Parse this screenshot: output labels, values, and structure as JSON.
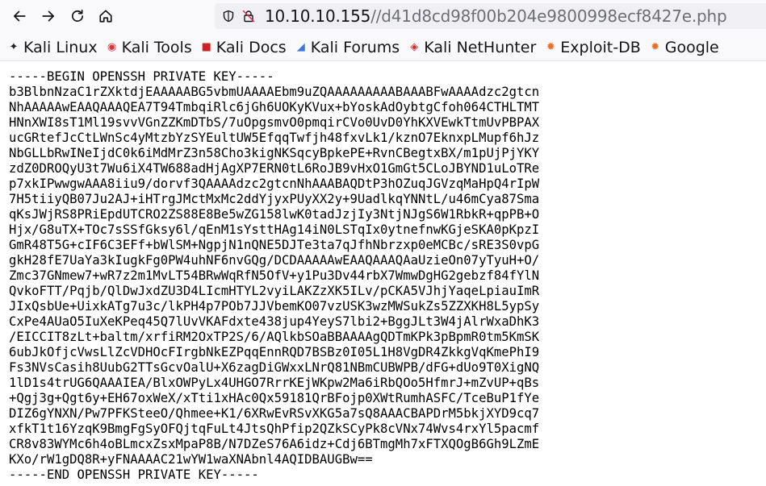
{
  "browser": {
    "url_host": "10.10.10.155",
    "url_path": "//d41d8cd98f00b204e9800998ecf8427e.php"
  },
  "bookmarks": [
    {
      "label": "Kali Linux",
      "icon": "kali-dragon-icon",
      "color": "#222222"
    },
    {
      "label": "Kali Tools",
      "icon": "kali-tools-icon",
      "color": "#d9383a"
    },
    {
      "label": "Kali Docs",
      "icon": "kali-docs-icon",
      "color": "#cc2222"
    },
    {
      "label": "Kali Forums",
      "icon": "kali-forums-icon",
      "color": "#3a7bd5"
    },
    {
      "label": "Kali NetHunter",
      "icon": "kali-nethunter-icon",
      "color": "#d12a2a"
    },
    {
      "label": "Exploit-DB",
      "icon": "exploit-db-icon",
      "color": "#e8702a"
    },
    {
      "label": "Google",
      "icon": "google-icon",
      "color": "#e8702a"
    }
  ],
  "page": {
    "lines": [
      "-----BEGIN OPENSSH PRIVATE KEY-----",
      "b3BlbnNzaC1rZXktdjEAAAAABG5vbmUAAAAEbm9uZQAAAAAAAAABAAABFwAAAAdzc2gtcn",
      "NhAAAAAwEAAQAAAQEA7T94TmbqiRlc6jGh6UOKyKVux+bYoskAdOybtgCfoh064CTHLTMT",
      "HNnXWI8sT1Ml19svvVGnZZKmDTbS/7uOpgsmvO0pmqirCVo0UvD0YhKXVEwkTtmUvPBPAX",
      "ucGRtefJcCtLWnSc4yMtzbYzSYEultUW5EfqqTwfjh48fxvLk1/kznO7EknxpLMupf6hJz",
      "NbGLLbRwINeIjdC0k6iMdMrZ3n58Cho3kigNKSqcyBpkePE+RvnCBegtxBX/m1pUjPjYKY",
      "zdZ0DROQyU3t7Wu6iX4TW688adHjAgXP7ERN0tL6RoJB9vHxO1GmGt5CLoJBYND1uLoTRe",
      "p7xkIPwwgwAAA8iiu9/dorvf3QAAAAdzc2gtcnNhAAABAQDtP3hOZuqJGVzqMaHpQ4rIpW",
      "7H5tiiyQB07Ju2AJ+iHTrgJMctMxMc2ddYjyxPUyXX2y+9UadlkqYNNtL/u46mCya87Sma",
      "qKsJWjRS8PRiEpdUTCRO2ZS88E8Be5wZG158lwK0tadJzjIy3NtjNJgS6W1RbkR+qpPB+O",
      "Hjx/G8uTX+TOc7sSSfGksy6l/qEnM1sYsttHAg14iN0LSTqIx0ytnefnwKGjeSKA0pKpzI",
      "GmR48T5G+cIF6C3EFf+bWlSM+NgpjN1nQNE5DJTe3ta7qJfhNbrzxp0eMCBc/sRE3S0vpG",
      "gkH28fE7UaYa3kIugkFg0PW4uhNF6nvGQg/DCDAAAAAwEAAQAAAQAaUzieOn07yTyuH+O/",
      "Zmc37GNmew7+wR7z2m1MvLT54BRwWqRfN5OfV+y1Pu3Dv44rbX7WmwDgHG2gebzf84fYlN",
      "QvkoFTT/Pqjb/QlDwJxdZU3D4LIcmHTYL2vyiLAKZzXK5ILv/pCKA5VJhjYaqeLpiauImR",
      "JIxQsbUe+UixkATg7u3c/lkPH4p7POb7JJVbemKO07vzUSK3wzMWSukZs5ZZXKH8L5ypSy",
      "CxPe4AUaO5IuXeKPeq45Q7lUvVKAFdxte438jup4YeyS7lbi2+BggJLt3W4jAlrWxaDhK3",
      "/EICCIT8zLt+baltm/xrfiRM2OxTP2S/6/AQlkbSOaBBAAAAgQDTmKPk3pBpmR0tm5KmSK",
      "6ubJkOfjcVwsLlZcVDHOcFIrgbNkEZPqqEnnRQD7BSBz0I05L1H8VgDR4ZkkgVqKmePhI9",
      "Fs3NVsCasih8UubG2TTsGcvOalU+X6zagDiGWxxLNrQ81NBmCUBWPB/dFG+dUo9T0XigNQ",
      "1lD1s4trUG6QAAAIEA/BlxOWPyLx4UHGO7RrrKEjWKpw2Ma6iRbQOo5HfmrJ+mZvUP+qBs",
      "+Qgj3g+Qgt6y+EH67oxWeX/xTti1xHAc0Qx59181QrBFojp0XWtRumhASFC/TceBuP1fYe",
      "DIZ6gYNXN/Pw7PFKSteeO/Qhmee+K1/6XRwEvRSvXKG5a7sQ8AAACBAPDrM5bkjXYD9cq7",
      "xfkT1t16YzqK9BmgFgSyOFQjtqFuLt4JtsQhPfip2QZkSCyPk8cVNx74Wvs4rxYl5pacmf",
      "CR8v83WYMc6h4oBLmcxZsxMpaP8B/N7DZeS76A6idz+Cdj6BTmgMh7xFTXQOgB6Gh9LZmE",
      "KXo/rW1gDQ8R+yFNAAAAC21wYW1waXNAbnl4AQIDBAUGBw==",
      "-----END OPENSSH PRIVATE KEY-----"
    ]
  }
}
